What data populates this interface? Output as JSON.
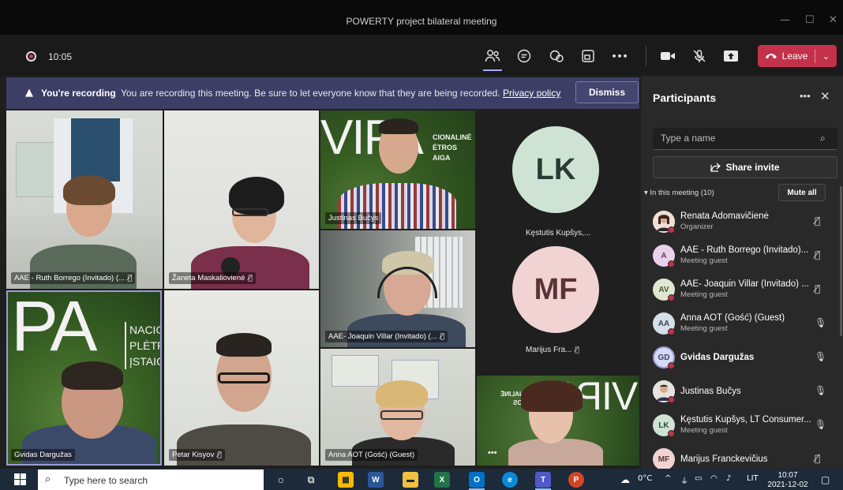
{
  "window": {
    "title": "POWERTY project bilateral meeting",
    "minimize": "—",
    "maximize": "☐",
    "close": "✕"
  },
  "toolbar": {
    "timer": "10:05",
    "leave_label": "Leave",
    "more_label": "•••"
  },
  "banner": {
    "heading": "You're recording",
    "message": "You are recording this meeting. Be sure to let everyone know that they are being recorded.",
    "link": "Privacy policy",
    "dismiss": "Dismiss"
  },
  "tiles": [
    {
      "label": "AAE - Ruth Borrego (Invitado) (...",
      "muted": true
    },
    {
      "label": "Žaneta Maskalioviené",
      "muted": true
    },
    {
      "label": "Justinas Bučys",
      "muted": false
    },
    {
      "label": "AAE- Joaquin Villar (Invitado) (...",
      "muted": true
    },
    {
      "label": "Gvidas Dargužas",
      "muted": false
    },
    {
      "label": "Petar Kisyov",
      "muted": true
    },
    {
      "label": "Anna AOT (Gość) (Guest)",
      "muted": false
    }
  ],
  "tile_text": {
    "vipa1": "VIPA",
    "vipa1_side": "CIONALINĖ\nĖTROS\nAIGA",
    "pa": "PA",
    "pa_side": "NACIO\nPLĖTR\nĮSTAIG",
    "vipa2": "VIPA",
    "vipa2_side": "IONALINĖ\nTROS"
  },
  "avatars": [
    {
      "initials": "LK",
      "name": "Kęstutis Kupšys,...",
      "color": "#cfe3d4",
      "muted": false
    },
    {
      "initials": "MF",
      "name": "Marijus Fra...",
      "color": "#f2d3d3",
      "muted": true
    }
  ],
  "participants_panel": {
    "title": "Participants",
    "search_placeholder": "Type a name",
    "share_invite": "Share invite",
    "in_meeting": "In this meeting (10)",
    "mute_all": "Mute all",
    "more": "•••",
    "close": "✕",
    "people": [
      {
        "name": "Renata Adomavičienė",
        "role": "Organizer",
        "initials": "",
        "color": "#e8d6cf",
        "status": "#c4314b",
        "muted": true
      },
      {
        "name": "AAE - Ruth Borrego (Invitado)...",
        "role": "Meeting guest",
        "initials": "A",
        "color": "#ead3ea",
        "status": "#c4314b",
        "muted": true
      },
      {
        "name": "AAE- Joaquin Villar (Invitado) ...",
        "role": "Meeting guest",
        "initials": "AV",
        "color": "#dfe6d2",
        "status": "#c4314b",
        "muted": true
      },
      {
        "name": "Anna AOT (Gość) (Guest)",
        "role": "Meeting guest",
        "initials": "AA",
        "color": "#d6dfe8",
        "status": "#c4314b",
        "muted": false
      },
      {
        "name": "Gvidas Dargužas",
        "role": "",
        "initials": "GD",
        "color": "#d6daf2",
        "status": "#c4314b",
        "muted": false
      },
      {
        "name": "Justinas Bučys",
        "role": "",
        "initials": "",
        "color": "#d9d4cf",
        "status": "#c4314b",
        "muted": false
      },
      {
        "name": "Kęstutis Kupšys, LT Consumer...",
        "role": "Meeting guest",
        "initials": "LK",
        "color": "#cfe3d4",
        "status": "#c4314b",
        "muted": false
      },
      {
        "name": "Marijus Franckevičius",
        "role": "",
        "initials": "MF",
        "color": "#f2d3d3",
        "status": "#c4314b",
        "muted": true
      }
    ]
  },
  "taskbar": {
    "search_placeholder": "Type here to search",
    "temperature": "0°C",
    "language": "LIT",
    "time": "10:07",
    "date": "2021-12-02"
  },
  "icons": {
    "mic_on": "🎤",
    "mic_off": "🎤̸"
  }
}
